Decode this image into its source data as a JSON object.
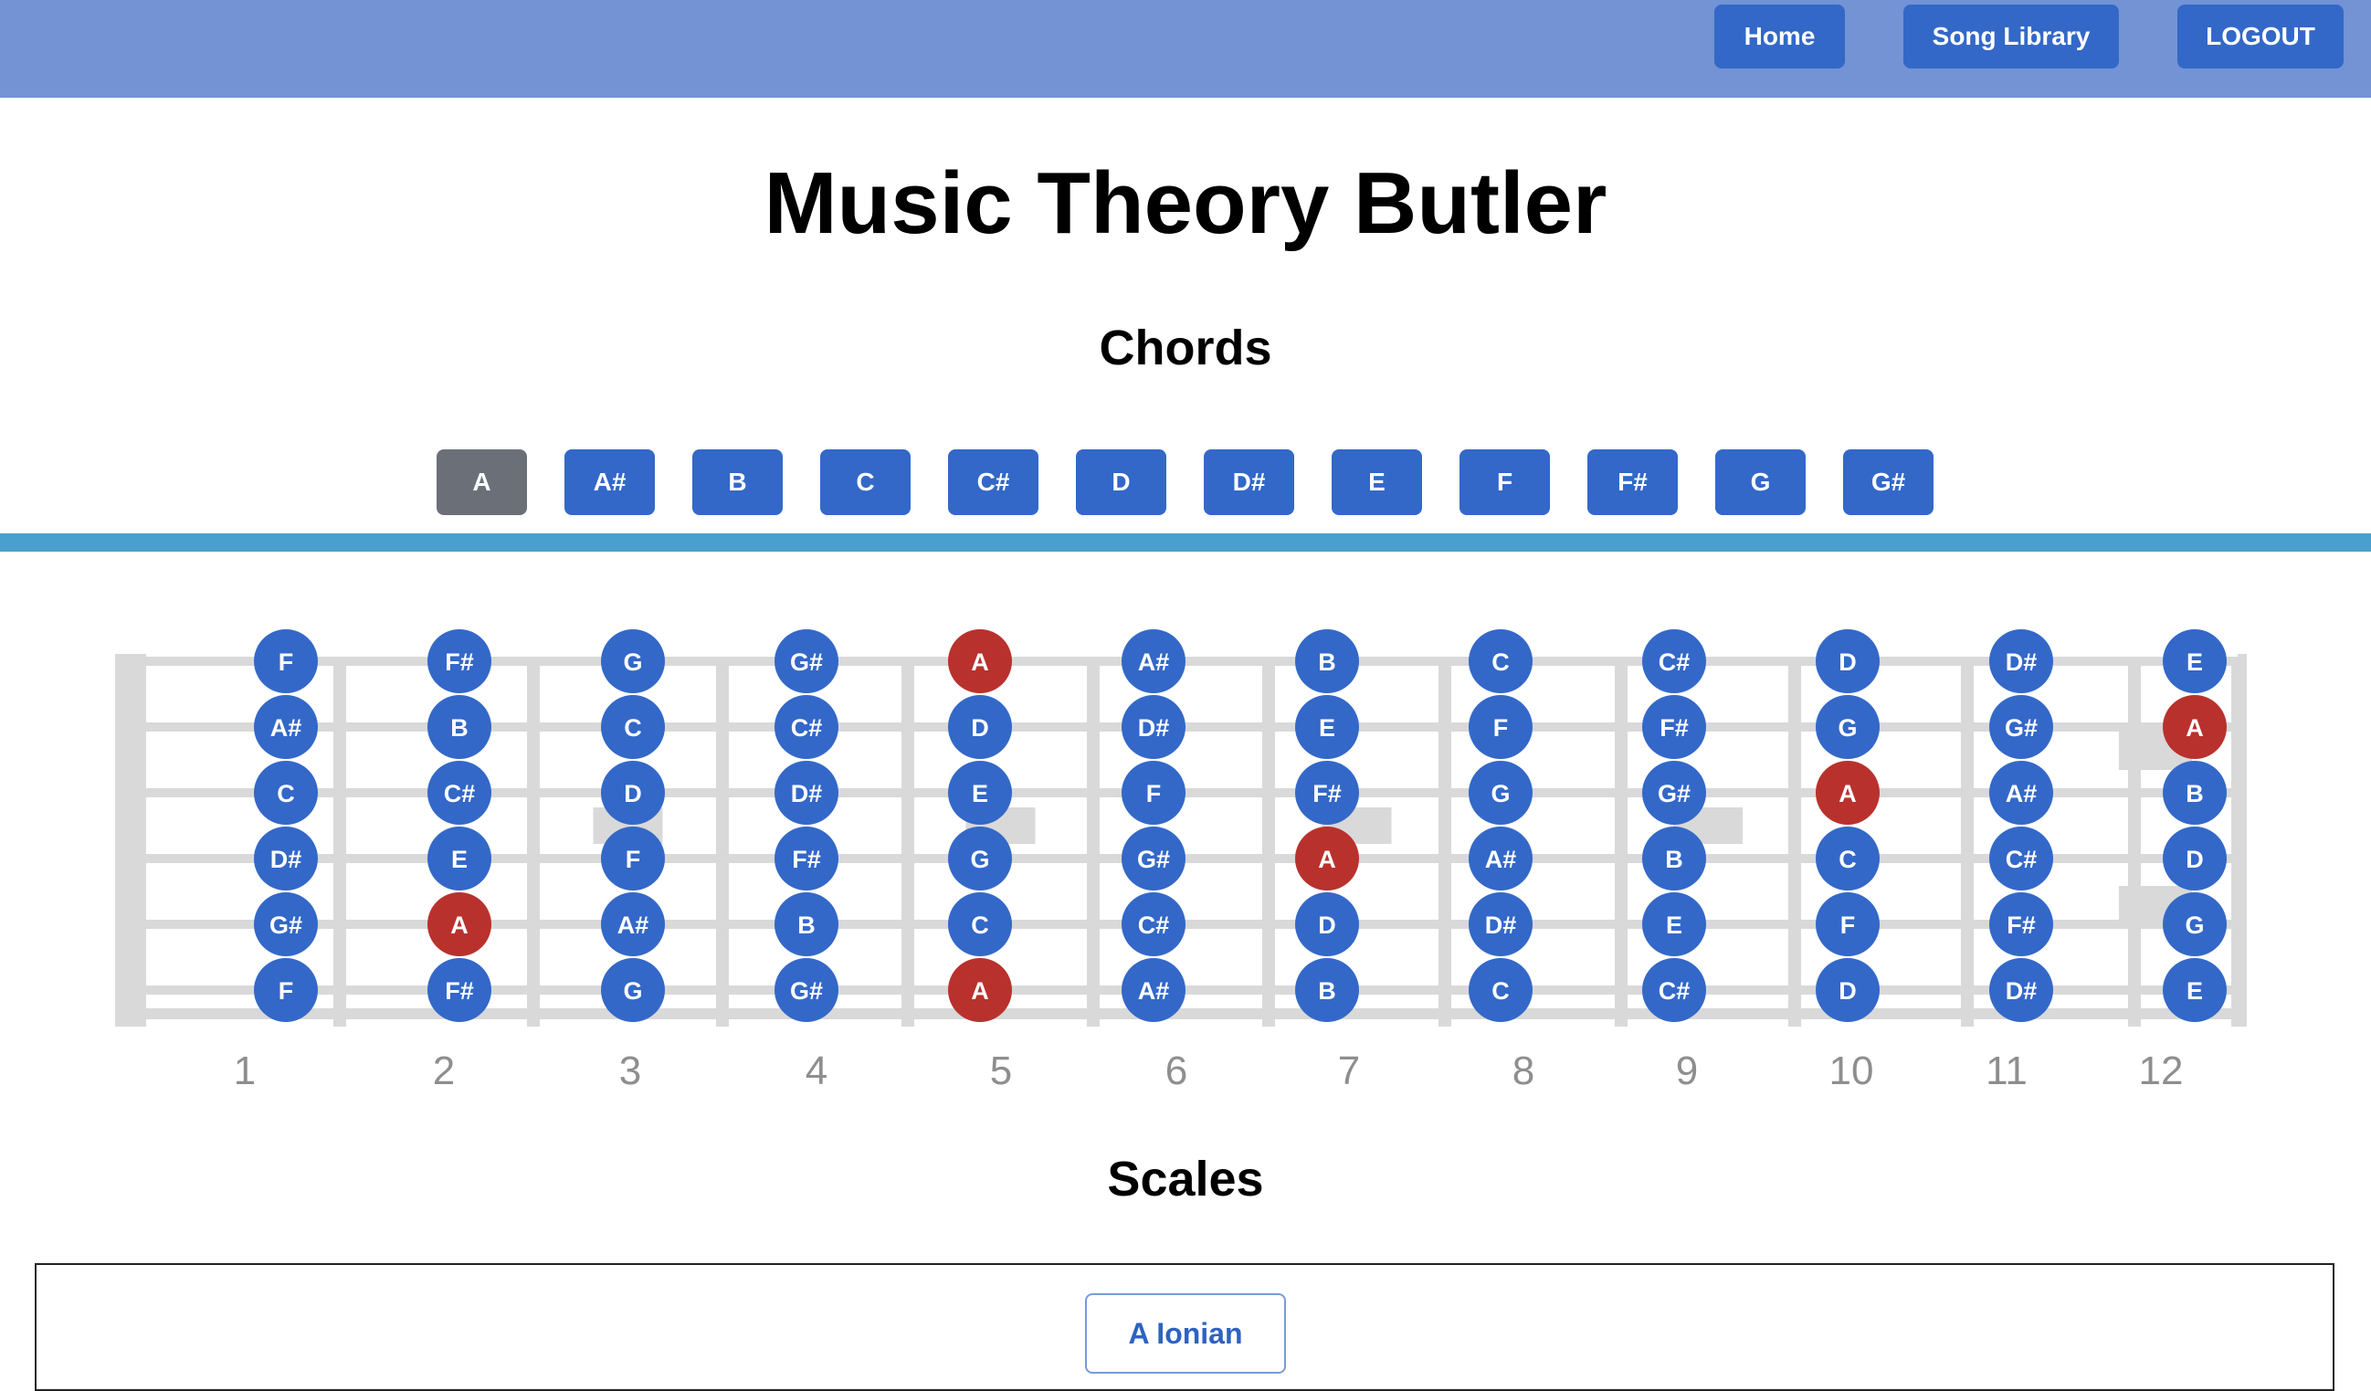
{
  "nav": {
    "home_label": "Home",
    "song_library_label": "Song Library",
    "logout_label": "LOGOUT"
  },
  "page_title": "Music Theory Butler",
  "chords": {
    "title": "Chords",
    "buttons": [
      "A",
      "A#",
      "B",
      "C",
      "C#",
      "D",
      "D#",
      "E",
      "F",
      "F#",
      "G",
      "G#"
    ],
    "selected": "A"
  },
  "fretboard": {
    "fret_numbers": [
      "1",
      "2",
      "3",
      "4",
      "5",
      "6",
      "7",
      "8",
      "9",
      "10",
      "11",
      "12"
    ],
    "notes": [
      [
        "F",
        "A#",
        "C",
        "D#",
        "G#",
        "F"
      ],
      [
        "F#",
        "B",
        "C#",
        "E",
        "A",
        "F#"
      ],
      [
        "G",
        "C",
        "D",
        "F",
        "A#",
        "G"
      ],
      [
        "G#",
        "C#",
        "D#",
        "F#",
        "B",
        "G#"
      ],
      [
        "A",
        "D",
        "E",
        "G",
        "C",
        "A"
      ],
      [
        "A#",
        "D#",
        "F",
        "G#",
        "C#",
        "A#"
      ],
      [
        "B",
        "E",
        "F#",
        "A",
        "D",
        "B"
      ],
      [
        "C",
        "F",
        "G",
        "A#",
        "D#",
        "C"
      ],
      [
        "C#",
        "F#",
        "G#",
        "B",
        "E",
        "C#"
      ],
      [
        "D",
        "G",
        "A",
        "C",
        "F",
        "D"
      ],
      [
        "D#",
        "G#",
        "A#",
        "C#",
        "F#",
        "D#"
      ],
      [
        "E",
        "A",
        "B",
        "D",
        "G",
        "E"
      ]
    ],
    "highlight_note": "A",
    "colors": {
      "note": "#3368c8",
      "highlight": "#b9312d",
      "board": "#d9d9d9"
    }
  },
  "scales": {
    "title": "Scales",
    "selected_label": "A Ionian"
  }
}
